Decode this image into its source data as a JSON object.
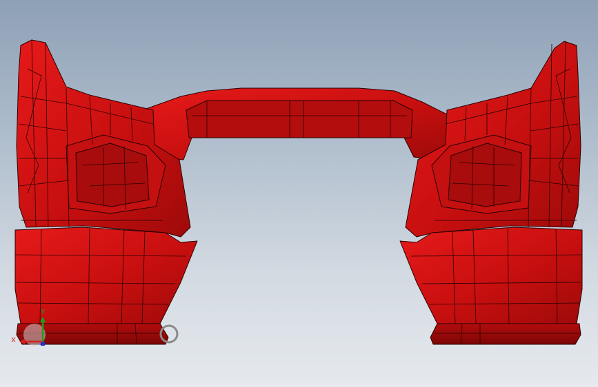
{
  "viewport": {
    "background_top": "#8ea0b6",
    "background_bottom": "#e6eaee"
  },
  "model": {
    "surface_color": "#cc1111",
    "edge_color": "#2a0000"
  },
  "triad": {
    "x_label": "X",
    "y_label": "Y",
    "x_color": "#d42020",
    "y_color": "#19a319",
    "z_color": "#1d2fd0"
  },
  "rotation_indicator": {
    "icon": "rotate-circle-icon",
    "color": "#8a8a8a"
  }
}
